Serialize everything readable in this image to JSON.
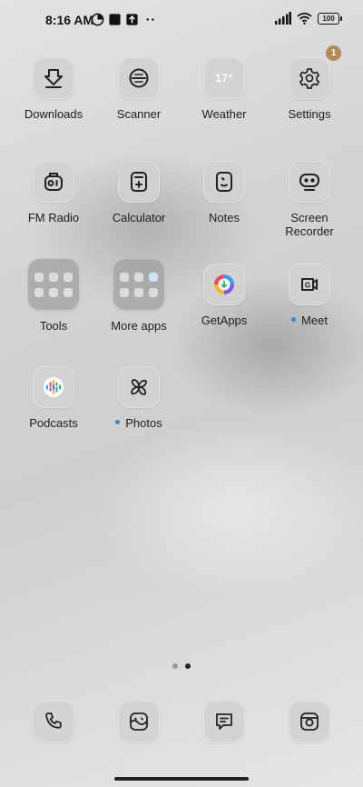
{
  "status": {
    "time": "8:16 AM",
    "left_icons": [
      "data-saver-icon",
      "square-notification-icon",
      "upload-notification-icon",
      "more-dots-icon"
    ],
    "right_icons": [
      "signal-icon",
      "wifi-icon"
    ],
    "battery": "100"
  },
  "apps": [
    {
      "label": "Downloads",
      "icon": "download-icon"
    },
    {
      "label": "Scanner",
      "icon": "scanner-icon"
    },
    {
      "label": "Weather",
      "icon": "weather-icon",
      "icon_text": "17°"
    },
    {
      "label": "Settings",
      "icon": "gear-icon",
      "badge": "1"
    },
    {
      "label": "FM Radio",
      "icon": "radio-icon"
    },
    {
      "label": "Calculator",
      "icon": "calculator-icon"
    },
    {
      "label": "Notes",
      "icon": "notes-icon"
    },
    {
      "label": "Screen Recorder",
      "line1": "Screen",
      "line2": "Recorder",
      "icon": "screen-recorder-icon"
    },
    {
      "label": "Tools",
      "icon": "folder-icon"
    },
    {
      "label": "More apps",
      "icon": "folder-icon"
    },
    {
      "label": "GetApps",
      "icon": "getapps-icon"
    },
    {
      "label": "Meet",
      "icon": "meet-icon",
      "new": true
    },
    {
      "label": "Podcasts",
      "icon": "podcasts-icon"
    },
    {
      "label": "Photos",
      "icon": "pinwheel-icon",
      "new": true
    }
  ],
  "pages": {
    "count": 2,
    "active": 2
  },
  "dock": [
    {
      "name": "Phone",
      "icon": "phone-icon"
    },
    {
      "name": "Gallery",
      "icon": "gallery-icon"
    },
    {
      "name": "Messages",
      "icon": "message-icon"
    },
    {
      "name": "Camera",
      "icon": "camera-icon"
    }
  ]
}
